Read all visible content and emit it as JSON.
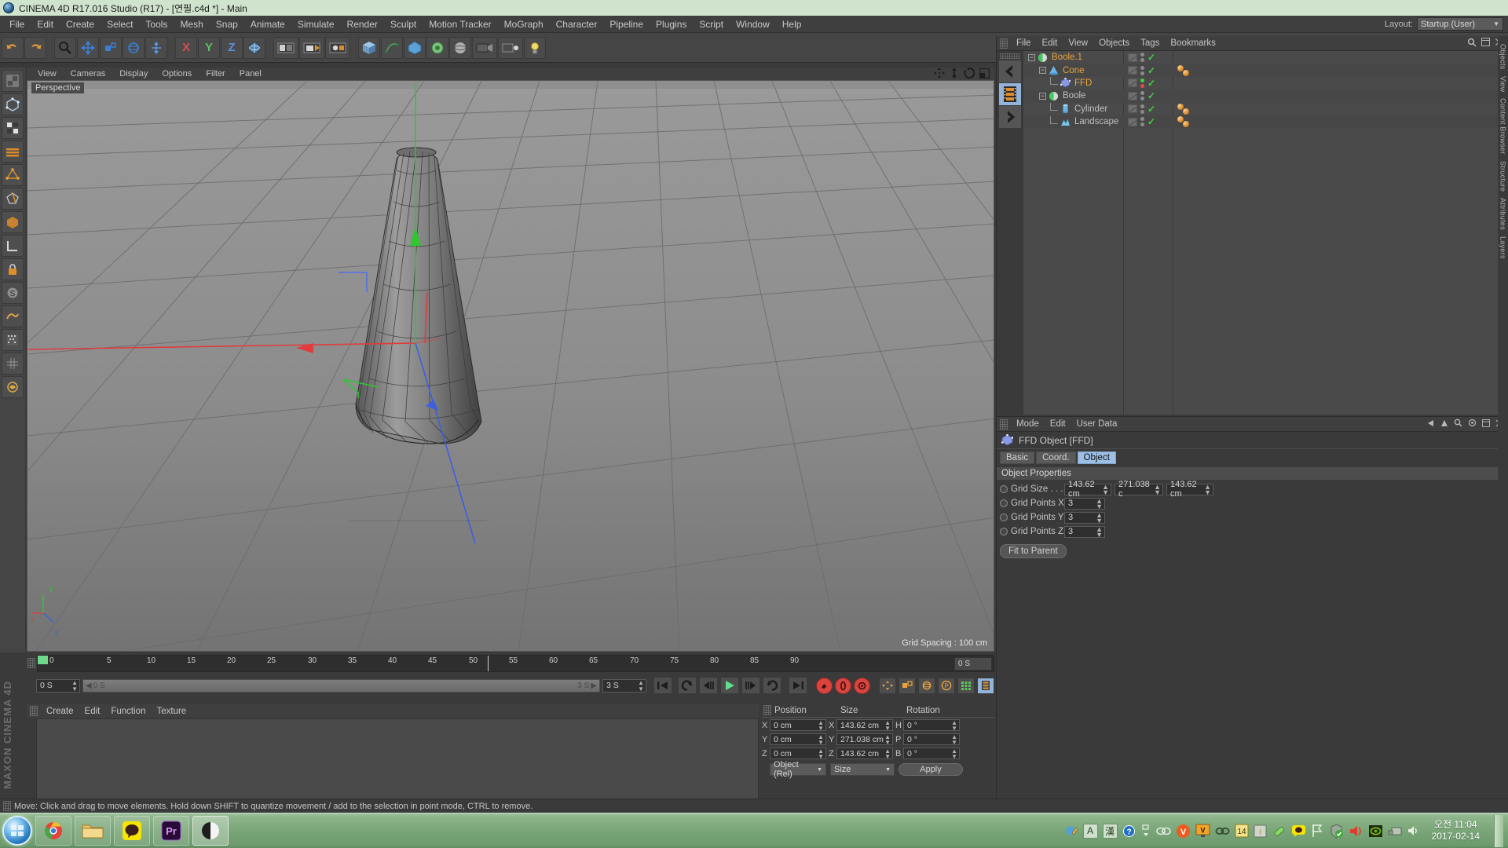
{
  "window": {
    "title": "CINEMA 4D R17.016 Studio (R17) - [연필.c4d *] - Main"
  },
  "menubar": {
    "items": [
      "File",
      "Edit",
      "Create",
      "Select",
      "Tools",
      "Mesh",
      "Snap",
      "Animate",
      "Simulate",
      "Render",
      "Sculpt",
      "Motion Tracker",
      "MoGraph",
      "Character",
      "Pipeline",
      "Plugins",
      "Script",
      "Window",
      "Help"
    ],
    "layout_label": "Layout:",
    "layout_value": "Startup (User)"
  },
  "viewport": {
    "menu": [
      "View",
      "Cameras",
      "Display",
      "Options",
      "Filter",
      "Panel"
    ],
    "camera_label": "Perspective",
    "grid_spacing": "Grid Spacing : 100 cm",
    "axis_x": "x",
    "axis_y": "y",
    "axis_z": "z"
  },
  "object_manager": {
    "menu": [
      "File",
      "Edit",
      "View",
      "Objects",
      "Tags",
      "Bookmarks"
    ],
    "rows": [
      {
        "name": "Boole.1",
        "icon": "boole-icon",
        "color": "orange",
        "depth": 0,
        "twisty": "-",
        "tags": true,
        "balls": 0
      },
      {
        "name": "Cone",
        "icon": "cone-icon",
        "color": "orange",
        "depth": 1,
        "twisty": "-",
        "tags": true,
        "balls": 2
      },
      {
        "name": "FFD",
        "icon": "ffd-icon",
        "color": "orange",
        "depth": 2,
        "twisty": "",
        "tags": true,
        "balls": 0,
        "dot_top": "green",
        "dot_bottom": "red"
      },
      {
        "name": "Boole",
        "icon": "boole-icon",
        "color": "grey",
        "depth": 1,
        "twisty": "-",
        "tags": true,
        "balls": 0
      },
      {
        "name": "Cylinder",
        "icon": "cylinder-icon",
        "color": "grey",
        "depth": 2,
        "twisty": "",
        "tags": true,
        "balls": 2
      },
      {
        "name": "Landscape",
        "icon": "landscape-icon",
        "color": "grey",
        "depth": 2,
        "twisty": "",
        "tags": true,
        "balls": 2
      }
    ]
  },
  "attribute_manager": {
    "menu": [
      "Mode",
      "Edit",
      "User Data"
    ],
    "object_title": "FFD Object [FFD]",
    "tabs": [
      {
        "label": "Basic",
        "active": false
      },
      {
        "label": "Coord.",
        "active": false
      },
      {
        "label": "Object",
        "active": true
      }
    ],
    "section_title": "Object Properties",
    "properties": [
      {
        "label": "Grid Size . . .",
        "values": [
          "143.62 cm",
          "271.038 c",
          "143.62 cm"
        ]
      },
      {
        "label": "Grid Points X",
        "values": [
          "3"
        ]
      },
      {
        "label": "Grid Points Y",
        "values": [
          "3"
        ]
      },
      {
        "label": "Grid Points Z",
        "values": [
          "3"
        ]
      }
    ],
    "fit_button": "Fit to Parent"
  },
  "timeline": {
    "ticks": [
      "0",
      "5",
      "10",
      "15",
      "20",
      "25",
      "30",
      "35",
      "40",
      "45",
      "50",
      "55",
      "60",
      "65",
      "70",
      "75",
      "80",
      "85",
      "90"
    ],
    "end_field": "0 S",
    "current_frame_field": "0 S",
    "scrub_value": "0 S",
    "scrub_right": "3 S",
    "range_field": "3 S"
  },
  "material_manager": {
    "menu": [
      "Create",
      "Edit",
      "Function",
      "Texture"
    ]
  },
  "coordinates": {
    "headers": [
      "Position",
      "Size",
      "Rotation"
    ],
    "rows": [
      {
        "pos_axis": "X",
        "pos": "0 cm",
        "size_axis": "X",
        "size": "143.62 cm",
        "rot_axis": "H",
        "rot": "0 °"
      },
      {
        "pos_axis": "Y",
        "pos": "0 cm",
        "size_axis": "Y",
        "size": "271.038 cm",
        "rot_axis": "P",
        "rot": "0 °"
      },
      {
        "pos_axis": "Z",
        "pos": "0 cm",
        "size_axis": "Z",
        "size": "143.62 cm",
        "rot_axis": "B",
        "rot": "0 °"
      }
    ],
    "mode_select": "Object (Rel)",
    "size_select": "Size",
    "apply_button": "Apply"
  },
  "statusbar": {
    "text": "Move: Click and drag to move elements. Hold down SHIFT to quantize movement / add to the selection in point mode, CTRL to remove."
  },
  "right_tabs": [
    "Objects",
    "View",
    "Content Browser",
    "Structure",
    "Attributes",
    "Layers"
  ],
  "watermark": {
    "line1": "MAXON",
    "line2": "CINEMA 4D"
  },
  "taskbar": {
    "clock_time": "오전 11:04",
    "clock_date": "2017-02-14",
    "ime_a": "A",
    "ime_han": "漢",
    "calendar_day": "14"
  },
  "colors": {
    "accent_blue": "#9dc0e4",
    "name_orange": "#e8a33d",
    "axis_x": "#d64d4d",
    "axis_y": "#5fc25f",
    "axis_z": "#5b8fe0",
    "record_red": "#d9443f",
    "play_green": "#5fe08f"
  }
}
